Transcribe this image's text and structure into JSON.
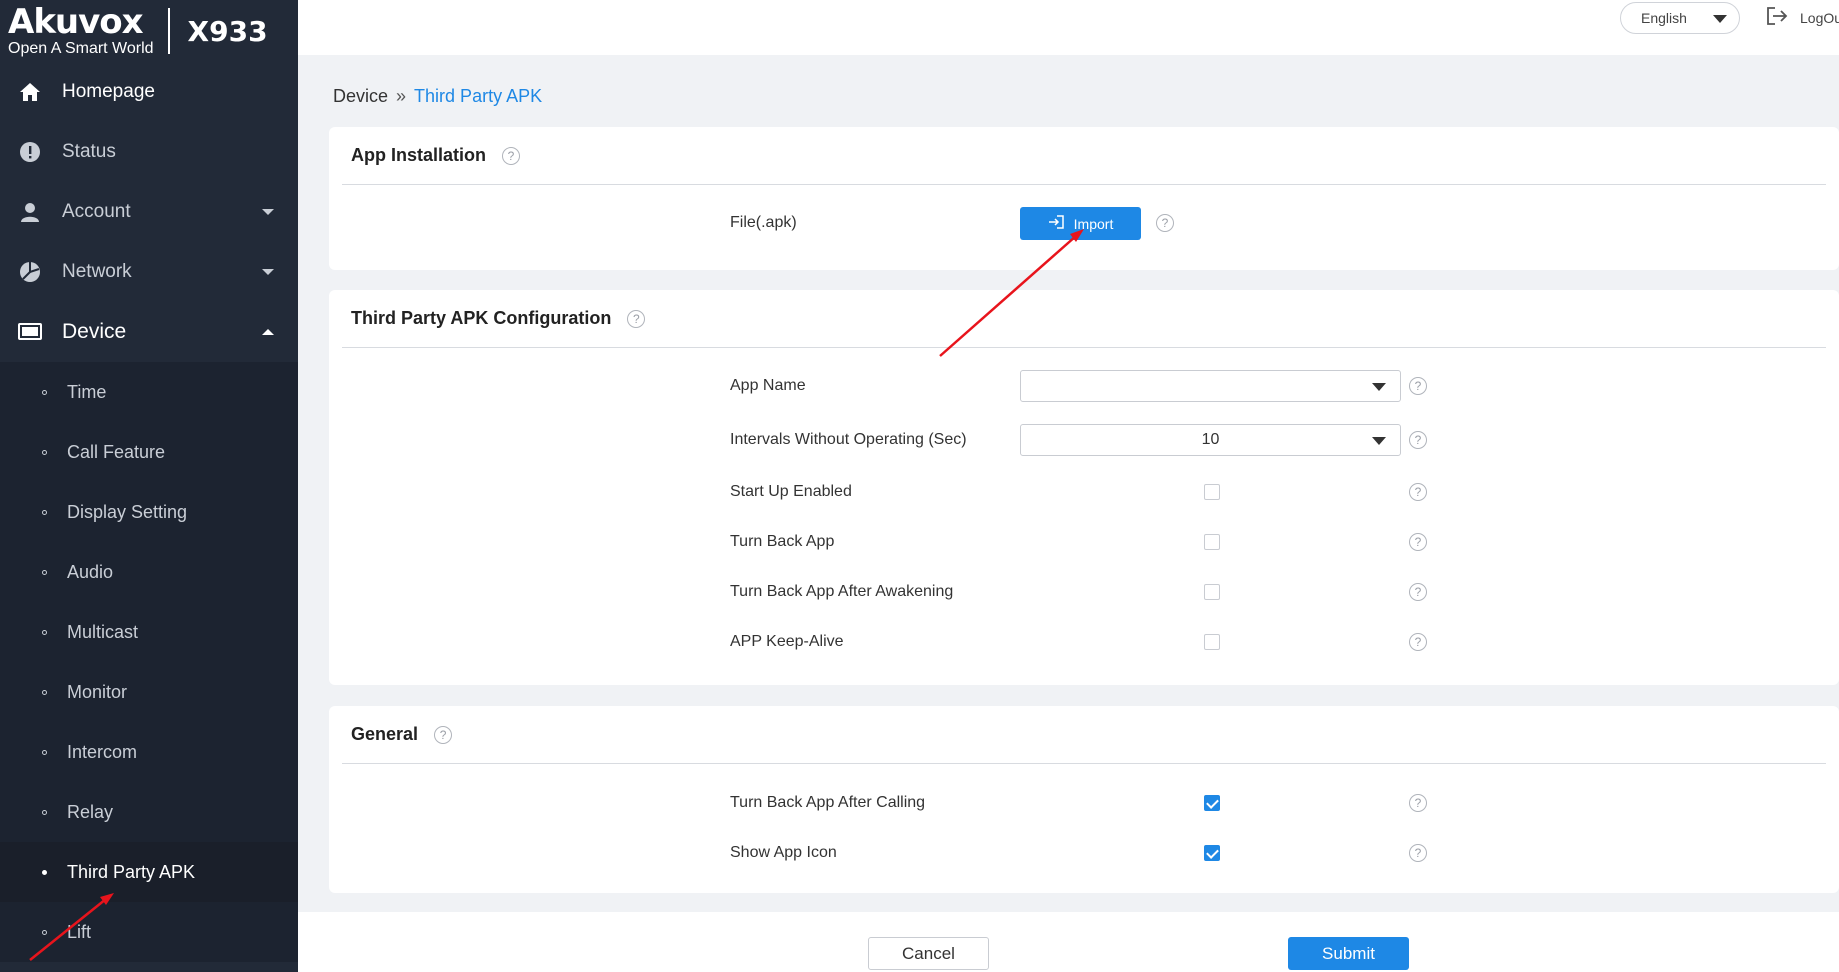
{
  "app": {
    "brand": "Akuvox",
    "tagline": "Open A Smart World",
    "model": "X933"
  },
  "topbar": {
    "language": "English",
    "logout_label": "LogOut"
  },
  "sidebar": {
    "homepage": "Homepage",
    "status": "Status",
    "account": "Account",
    "network": "Network",
    "device": "Device",
    "device_items": [
      "Time",
      "Call Feature",
      "Display Setting",
      "Audio",
      "Multicast",
      "Monitor",
      "Intercom",
      "Relay",
      "Third Party APK",
      "Lift"
    ]
  },
  "breadcrumb": {
    "root": "Device",
    "separator": "»",
    "current": "Third Party APK"
  },
  "app_installation": {
    "title": "App Installation",
    "file_label": "File(.apk)",
    "import_label": "Import"
  },
  "config": {
    "title": "Third Party APK Configuration",
    "app_name_label": "App Name",
    "app_name_value": "",
    "interval_label": "Intervals Without Operating (Sec)",
    "interval_value": "10",
    "start_up_label": "Start Up Enabled",
    "start_up_checked": false,
    "turn_back_label": "Turn Back App",
    "turn_back_checked": false,
    "turn_back_awaken_label": "Turn Back App After Awakening",
    "turn_back_awaken_checked": false,
    "keep_alive_label": "APP Keep-Alive",
    "keep_alive_checked": false
  },
  "general": {
    "title": "General",
    "after_calling_label": "Turn Back App After Calling",
    "after_calling_checked": true,
    "show_icon_label": "Show App Icon",
    "show_icon_checked": true
  },
  "footer": {
    "cancel": "Cancel",
    "submit": "Submit"
  },
  "colors": {
    "sidebar_bg": "#222a38",
    "accent": "#1e88e5",
    "annotation_arrow": "#e8141c"
  },
  "help_glyph": "?"
}
